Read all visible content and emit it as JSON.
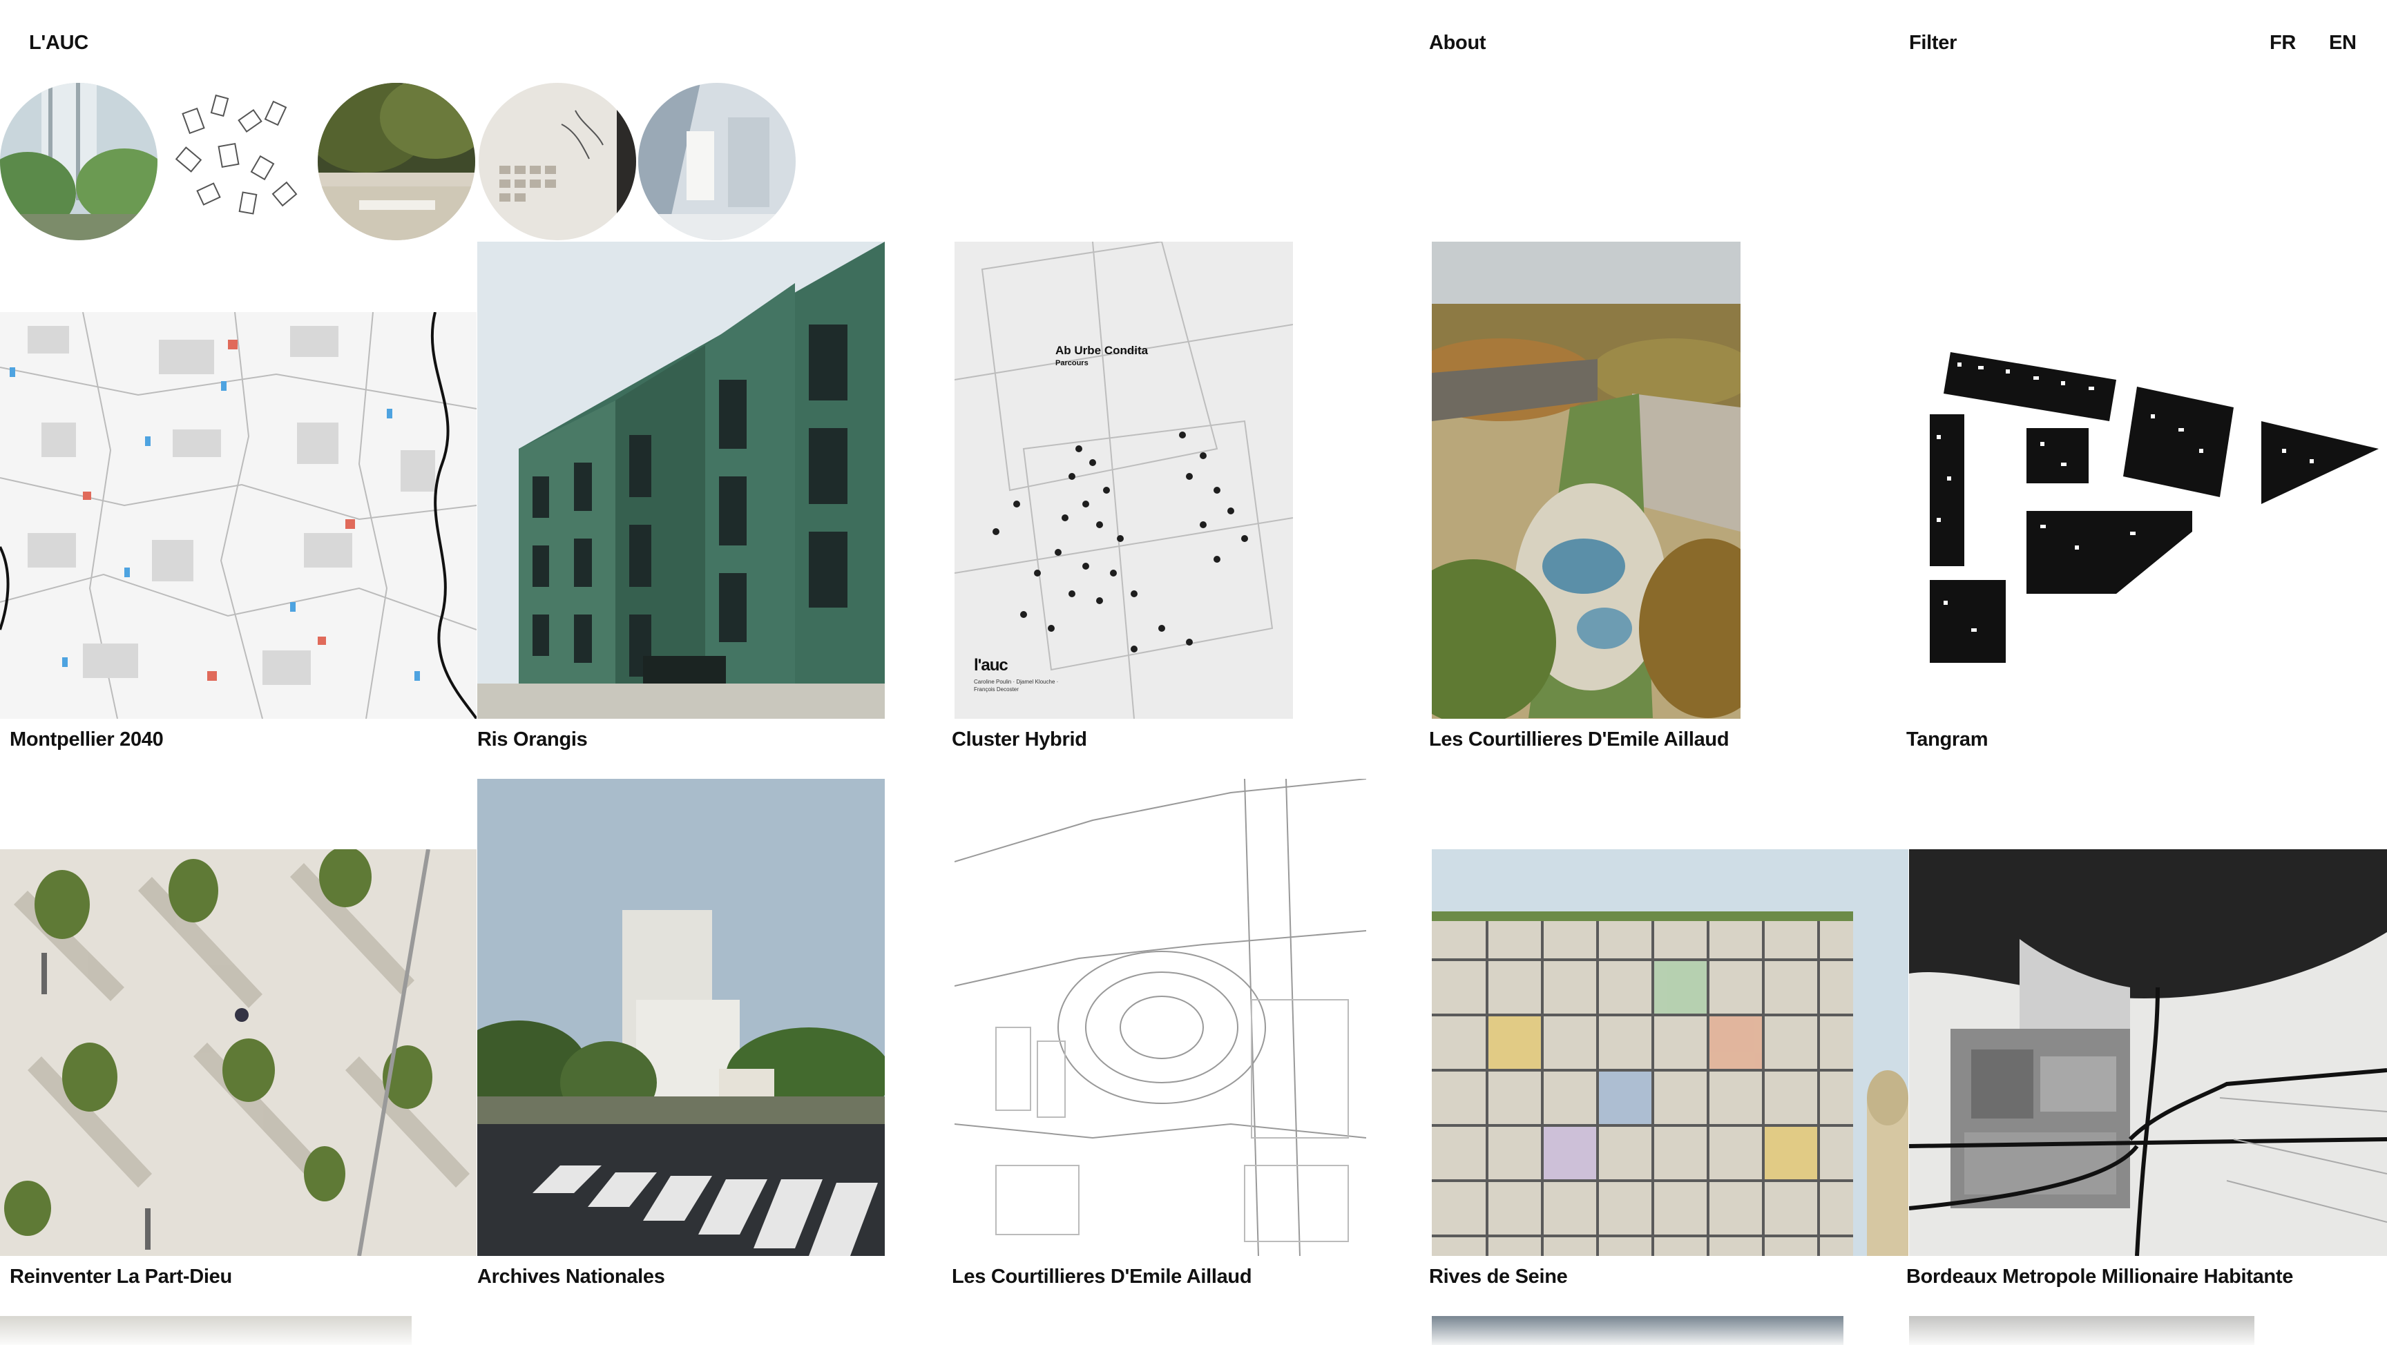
{
  "header": {
    "logo": "L'AUC",
    "about": "About",
    "filter": "Filter",
    "lang_fr": "FR",
    "lang_en": "EN"
  },
  "featured_circles": [
    {
      "name": "featured-project-tower-garden"
    },
    {
      "name": "featured-project-plan-fragments"
    },
    {
      "name": "featured-project-plaza-trees"
    },
    {
      "name": "featured-project-exhibition-wall"
    },
    {
      "name": "featured-project-model"
    }
  ],
  "projects": [
    {
      "title": "Montpellier 2040"
    },
    {
      "title": "Ris Orangis"
    },
    {
      "title": "Cluster Hybrid",
      "cover_title": "Ab Urbe Condita",
      "cover_subtitle": "Parcours",
      "cover_logo": "l'auc",
      "cover_authors": "Caroline Poulin · Djamel Klouche · François Decoster"
    },
    {
      "title": "Les Courtillieres D'Emile Aillaud"
    },
    {
      "title": "Tangram"
    },
    {
      "title": "Reinventer La Part-Dieu"
    },
    {
      "title": "Archives Nationales"
    },
    {
      "title": "Les Courtillieres D'Emile Aillaud"
    },
    {
      "title": "Rives de Seine"
    },
    {
      "title": "Bordeaux Metropole Millionaire Habitante"
    }
  ],
  "colors": {
    "background": "#ffffff",
    "text": "#111111",
    "facade_green": "#3e6e5c",
    "sky": "#a9bccb"
  }
}
